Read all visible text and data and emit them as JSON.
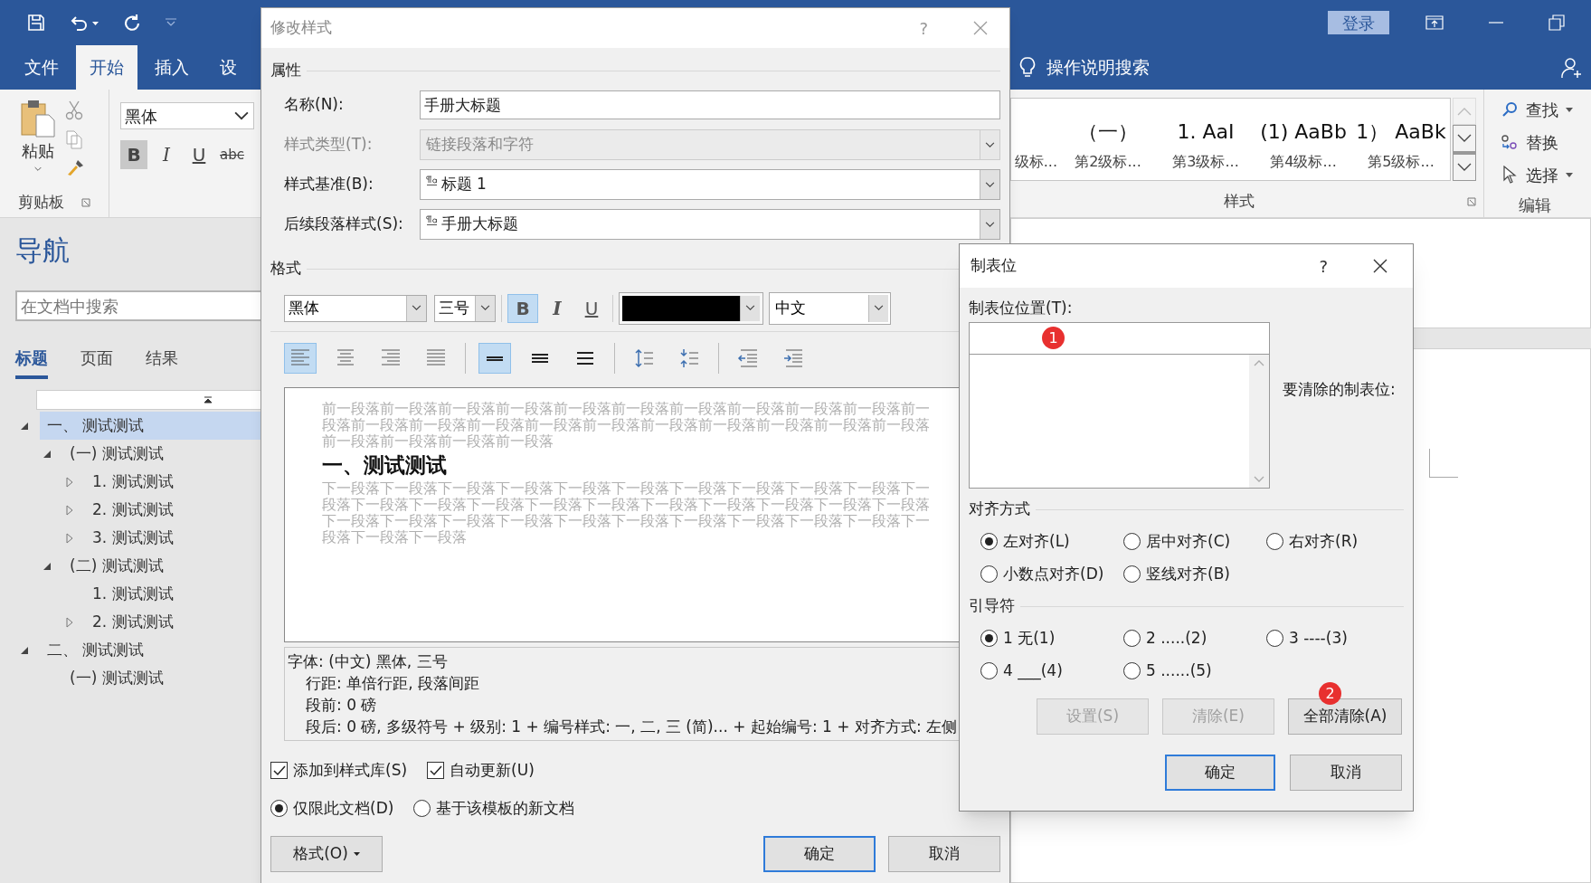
{
  "word": {
    "sign_in": "登录",
    "tell_me": "操作说明搜索",
    "ribbon_tabs": [
      {
        "label": "文件",
        "selected": false
      },
      {
        "label": "开始",
        "selected": true
      },
      {
        "label": "插入",
        "selected": false
      },
      {
        "label": "设",
        "selected": false
      }
    ],
    "clipboard": {
      "paste": "粘贴",
      "group_label": "剪贴板"
    },
    "font_group": {
      "font_name": "黑体",
      "buttons": [
        {
          "kind": "bold",
          "label": "B",
          "selected": true
        },
        {
          "kind": "italic",
          "label": "I",
          "selected": false
        },
        {
          "kind": "underline",
          "label": "U",
          "selected": false
        },
        {
          "kind": "strikethrough",
          "label": "abc",
          "selected": false
        }
      ]
    },
    "styles": {
      "group_label": "样式",
      "items": [
        {
          "label": "级标..."
        },
        {
          "preview": "（一）",
          "label": "第2级标..."
        },
        {
          "preview": "1. AaI",
          "label": "第3级标..."
        },
        {
          "preview": "(1) AaBb",
          "label": "第4级标..."
        },
        {
          "preview": "1） AaBk",
          "label": "第5级标..."
        }
      ]
    },
    "editing": {
      "group_label": "编辑",
      "items": [
        {
          "kind": "find",
          "label": "查找",
          "menu": true
        },
        {
          "kind": "replace",
          "label": "替换",
          "menu": false
        },
        {
          "kind": "select",
          "label": "选择",
          "menu": true
        }
      ]
    }
  },
  "navigation": {
    "title": "导航",
    "search": {
      "placeholder": "在文档中搜索"
    },
    "tabs": [
      {
        "label": "标题",
        "selected": true
      },
      {
        "label": "页面",
        "selected": false
      },
      {
        "label": "结果",
        "selected": false
      }
    ],
    "tree": [
      {
        "label": "一、 测试测试",
        "selected": true,
        "expanded": true,
        "children": [
          {
            "label": "(一) 测试测试",
            "selected": false,
            "expanded": true,
            "children": [
              {
                "label": "1. 测试测试",
                "selected": false,
                "expanded": false
              },
              {
                "label": "2. 测试测试",
                "selected": false,
                "expanded": false
              },
              {
                "label": "3. 测试测试",
                "selected": false,
                "expanded": false
              }
            ]
          },
          {
            "label": "(二) 测试测试",
            "selected": false,
            "expanded": true,
            "children": [
              {
                "label": "1. 测试测试",
                "selected": false
              },
              {
                "label": "2. 测试测试",
                "selected": false,
                "expanded": false
              }
            ]
          }
        ]
      },
      {
        "label": "二、 测试测试",
        "selected": false,
        "expanded": true,
        "children": [
          {
            "label": "(一) 测试测试",
            "selected": false
          }
        ]
      }
    ]
  },
  "modify_style_dialog": {
    "title": "修改样式",
    "help": "?",
    "properties_label": "属性",
    "fields": [
      {
        "label": "名称(N):",
        "kind": "text",
        "value": "手册大标题",
        "disabled": false
      },
      {
        "label": "样式类型(T):",
        "kind": "select",
        "value": "链接段落和字符",
        "disabled": true,
        "style_icon": false
      },
      {
        "label": "样式基准(B):",
        "kind": "select",
        "value": "标题 1",
        "disabled": false,
        "style_icon": true
      },
      {
        "label": "后续段落样式(S):",
        "kind": "select",
        "value": "手册大标题",
        "disabled": false,
        "style_icon": true
      }
    ],
    "format_label": "格式",
    "font": "黑体",
    "size": "三号",
    "font_buttons": [
      {
        "kind": "bold",
        "label": "B",
        "selected": true
      },
      {
        "kind": "italic",
        "label": "I",
        "selected": false
      },
      {
        "kind": "underline",
        "label": "U",
        "selected": false
      }
    ],
    "font_color": {
      "color": "#000000"
    },
    "script": "中文",
    "paragraph_groups": [
      {
        "buttons": [
          {
            "kind": "align-left",
            "selected": true
          },
          {
            "kind": "align-center",
            "selected": false
          },
          {
            "kind": "align-right",
            "selected": false
          },
          {
            "kind": "justify",
            "selected": false
          }
        ]
      },
      {
        "buttons": [
          {
            "kind": "single-spacing",
            "selected": true
          },
          {
            "kind": "one-half-spacing",
            "selected": false
          },
          {
            "kind": "double-spacing",
            "selected": false
          }
        ]
      },
      {
        "buttons": [
          {
            "kind": "increase-spacing",
            "selected": false
          },
          {
            "kind": "decrease-spacing",
            "selected": false
          }
        ]
      },
      {
        "buttons": [
          {
            "kind": "decrease-indent",
            "selected": false
          },
          {
            "kind": "increase-indent",
            "selected": false
          }
        ]
      }
    ],
    "preview": {
      "before": "前一段落前一段落前一段落前一段落前一段落前一段落前一段落前一段落前一段落前一段落前一段落前一段落前一段落前一段落前一段落前一段落前一段落前一段落前一段落前一段落前一段落前一段落前一段落前一段落前一段落",
      "heading": "一、测试测试",
      "after": "下一段落下一段落下一段落下一段落下一段落下一段落下一段落下一段落下一段落下一段落下一段落下一段落下一段落下一段落下一段落下一段落下一段落下一段落下一段落下一段落下一段落下一段落下一段落下一段落下一段落下一段落下一段落下一段落下一段落下一段落下一段落下一段落下一段落下一段落"
    },
    "description": [
      "字体: (中文) 黑体, 三号",
      "行距: 单倍行距, 段落间距",
      "段前: 0 磅",
      "段后: 0 磅, 多级符号 + 级别: 1 + 编号样式: 一, 二, 三 (简)... + 起始编号: 1 + 对齐方式: 左侧"
    ],
    "checkboxes": [
      {
        "label": "添加到样式库(S)",
        "checked": true
      },
      {
        "label": "自动更新(U)",
        "checked": true
      }
    ],
    "scope": [
      {
        "label": "仅限此文档(D)",
        "selected": true
      },
      {
        "label": "基于该模板的新文档",
        "selected": false
      }
    ],
    "format_button": "格式(O)",
    "ok": "确定",
    "cancel": "取消"
  },
  "tabs_dialog": {
    "title": "制表位",
    "help": "?",
    "position_label": "制表位位置(T):",
    "position_marker": "1",
    "clear_label": "要清除的制表位:",
    "alignment": {
      "label": "对齐方式",
      "options": [
        {
          "label": "左对齐(L)",
          "selected": true
        },
        {
          "label": "居中对齐(C)",
          "selected": false
        },
        {
          "label": "右对齐(R)",
          "selected": false
        },
        {
          "label": "小数点对齐(D)",
          "selected": false
        },
        {
          "label": "竖线对齐(B)",
          "selected": false
        }
      ]
    },
    "leader": {
      "label": "引导符",
      "options": [
        {
          "label": "1 无(1)",
          "selected": true
        },
        {
          "label": "2 .....(2)",
          "selected": false
        },
        {
          "label": "3 ----(3)",
          "selected": false
        },
        {
          "label": "4 ___(4)",
          "selected": false
        },
        {
          "label": "5 ......(5)",
          "selected": false
        }
      ]
    },
    "buttons": [
      {
        "label": "设置(S)",
        "disabled": true
      },
      {
        "label": "清除(E)",
        "disabled": true
      },
      {
        "label": "全部清除(A)",
        "disabled": false,
        "marker": "2"
      }
    ],
    "ok": "确定",
    "cancel": "取消"
  }
}
